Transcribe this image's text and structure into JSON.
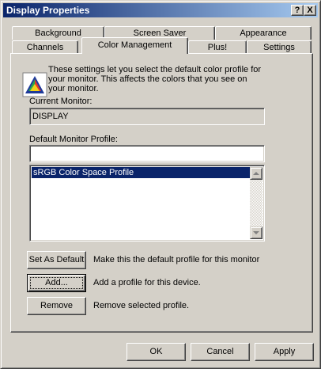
{
  "window": {
    "title": "Display Properties"
  },
  "titlebar_buttons": {
    "help": "?",
    "close": "X"
  },
  "tabs_back": [
    "Background",
    "Screen Saver",
    "Appearance"
  ],
  "tabs_front": [
    "Channels",
    "Color Management",
    "Plus!",
    "Settings"
  ],
  "selected_tab": "Color Management",
  "panel": {
    "description_lines": [
      "These settings let you select the default color profile for",
      "your monitor.  This affects the colors that you see on",
      "your monitor."
    ],
    "current_monitor_label": "Current Monitor:",
    "current_monitor_value": "DISPLAY",
    "default_profile_label": "Default Monitor Profile:",
    "default_profile_value": "",
    "profiles": [
      "sRGB Color Space Profile"
    ],
    "selected_profile_index": 0,
    "actions": [
      {
        "button": "Set As Default",
        "description": "Make this the default profile for this monitor"
      },
      {
        "button": "Add...",
        "description": "Add a profile for this device."
      },
      {
        "button": "Remove",
        "description": "Remove selected profile."
      }
    ]
  },
  "dialog_buttons": {
    "ok": "OK",
    "cancel": "Cancel",
    "apply": "Apply"
  },
  "colors": {
    "titlebar_start": "#0a246a",
    "titlebar_end": "#a6caf0",
    "face": "#d4d0c8",
    "selection": "#0a246a"
  }
}
